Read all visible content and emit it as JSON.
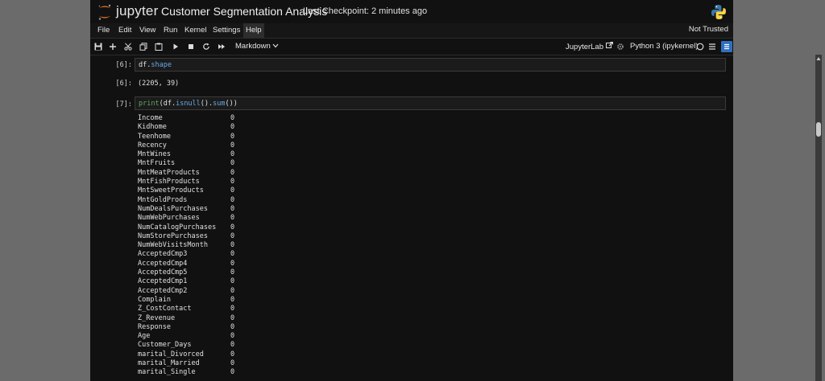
{
  "header": {
    "logo_text": "jupyter",
    "notebook_title": "Customer Segmentation Analysis",
    "checkpoint": "Last Checkpoint: 2 minutes ago"
  },
  "menu": {
    "items": [
      "File",
      "Edit",
      "View",
      "Run",
      "Kernel",
      "Settings",
      "Help"
    ],
    "trust_status": "Not Trusted"
  },
  "toolbar": {
    "cell_type": "Markdown",
    "jupyterlab_label": "JupyterLab",
    "kernel_name": "Python 3 (ipykernel)"
  },
  "cells": {
    "c6": {
      "in_prompt": "[6]:",
      "code_obj": "df",
      "code_dot": ".",
      "code_attr": "shape",
      "out_prompt": "[6]:",
      "output": "(2205, 39)"
    },
    "c7": {
      "in_prompt": "[7]:",
      "code_print": "print",
      "code_open": "(df.",
      "code_isnull": "isnull",
      "code_mid": "().",
      "code_sum": "sum",
      "code_close": "())"
    }
  },
  "series": [
    [
      "Income",
      "0"
    ],
    [
      "Kidhome",
      "0"
    ],
    [
      "Teenhome",
      "0"
    ],
    [
      "Recency",
      "0"
    ],
    [
      "MntWines",
      "0"
    ],
    [
      "MntFruits",
      "0"
    ],
    [
      "MntMeatProducts",
      "0"
    ],
    [
      "MntFishProducts",
      "0"
    ],
    [
      "MntSweetProducts",
      "0"
    ],
    [
      "MntGoldProds",
      "0"
    ],
    [
      "NumDealsPurchases",
      "0"
    ],
    [
      "NumWebPurchases",
      "0"
    ],
    [
      "NumCatalogPurchases",
      "0"
    ],
    [
      "NumStorePurchases",
      "0"
    ],
    [
      "NumWebVisitsMonth",
      "0"
    ],
    [
      "AcceptedCmp3",
      "0"
    ],
    [
      "AcceptedCmp4",
      "0"
    ],
    [
      "AcceptedCmp5",
      "0"
    ],
    [
      "AcceptedCmp1",
      "0"
    ],
    [
      "AcceptedCmp2",
      "0"
    ],
    [
      "Complain",
      "0"
    ],
    [
      "Z_CostContact",
      "0"
    ],
    [
      "Z_Revenue",
      "0"
    ],
    [
      "Response",
      "0"
    ],
    [
      "Age",
      "0"
    ],
    [
      "Customer_Days",
      "0"
    ],
    [
      "marital_Divorced",
      "0"
    ],
    [
      "marital_Married",
      "0"
    ],
    [
      "marital_Single",
      "0"
    ]
  ],
  "colors": {
    "accent": "#f37726",
    "code_function": "#5fa85f",
    "code_attribute": "#6aa9e6"
  }
}
